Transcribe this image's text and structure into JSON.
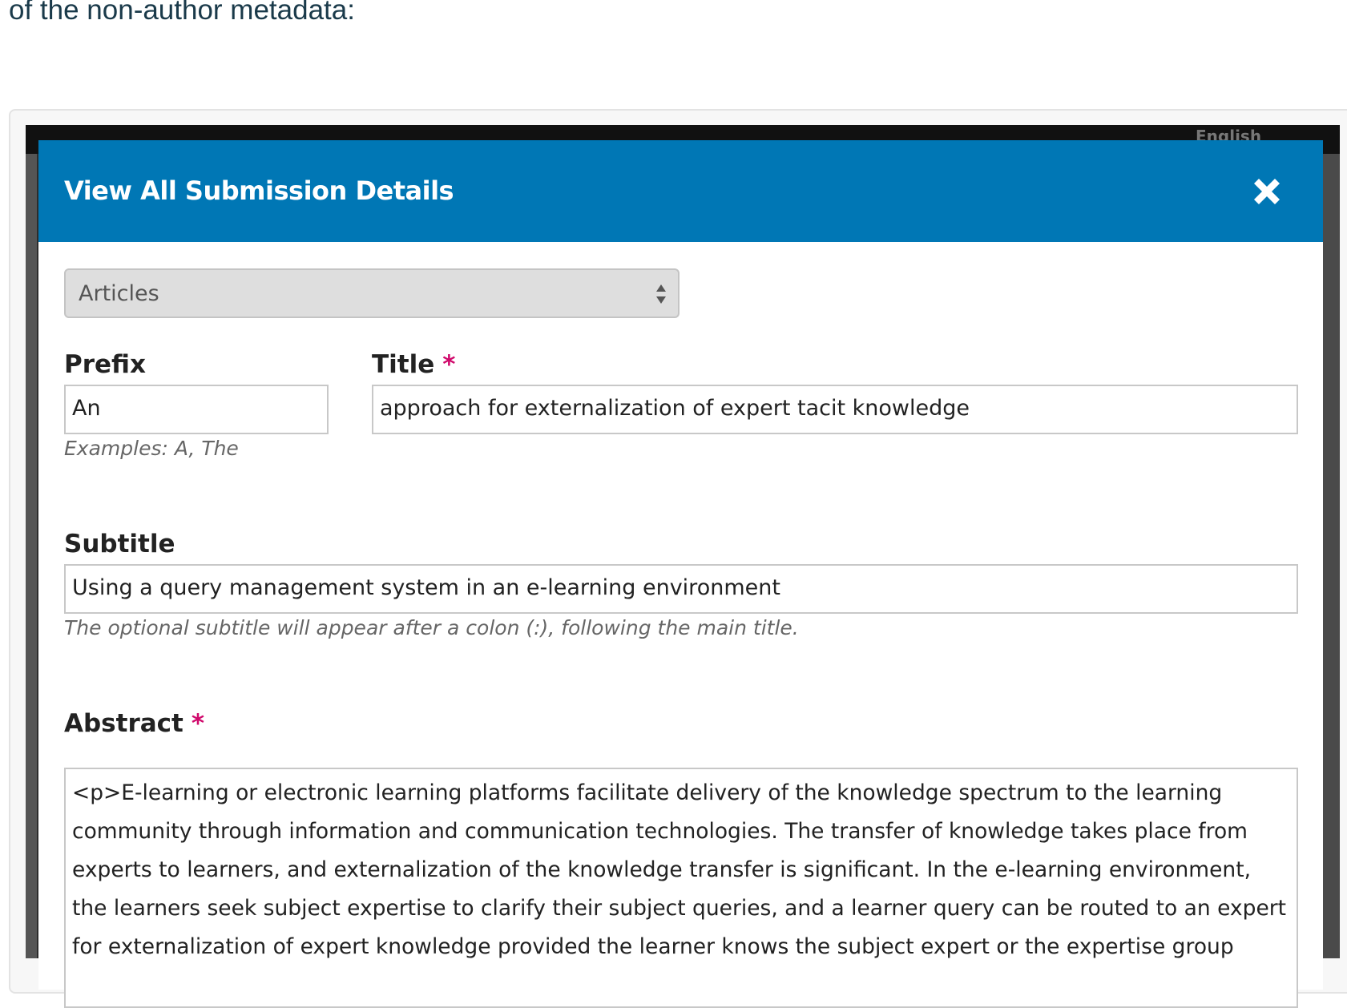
{
  "intro": {
    "text": "of the non-author metadata:"
  },
  "background": {
    "language_link": "English"
  },
  "modal": {
    "title": "View All Submission Details",
    "close_icon": "close-icon",
    "section_select": {
      "value": "Articles"
    },
    "prefix": {
      "label": "Prefix",
      "value": "An",
      "help": "Examples: A, The"
    },
    "title_field": {
      "label": "Title",
      "required_marker": "*",
      "value": "approach for externalization of expert tacit knowledge"
    },
    "subtitle": {
      "label": "Subtitle",
      "value": "Using a query management system in an e-learning environment",
      "help": "The optional subtitle will appear after a colon (:), following the main title."
    },
    "abstract": {
      "label": "Abstract",
      "required_marker": "*",
      "value": "<p>E-learning or electronic learning platforms facilitate delivery of the knowledge spectrum to the learning community through information and communication technologies. The transfer of knowledge takes place from experts to learners, and externalization of the knowledge transfer is significant. In the e-learning environment, the learners seek subject expertise to clarify their subject queries, and a learner query can be routed to an expert for externalization of expert knowledge provided the learner knows the subject expert or the expertise group"
    }
  },
  "colors": {
    "header": "#0077b5",
    "required": "#d00a6c",
    "overlay": "#2c2c2c"
  }
}
